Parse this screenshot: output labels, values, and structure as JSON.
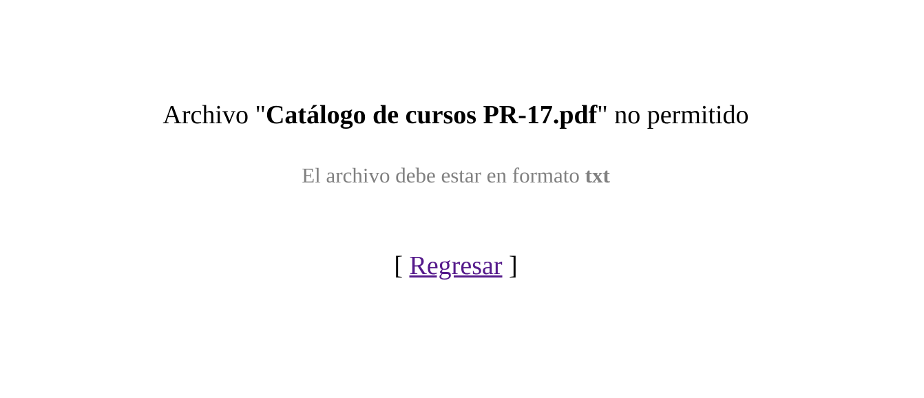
{
  "error": {
    "prefix": "Archivo \"",
    "filename": "Catálogo de cursos PR-17.pdf",
    "suffix": "\" no permitido"
  },
  "requirement": {
    "text": "El archivo debe estar en formato ",
    "format": "txt"
  },
  "back": {
    "open_bracket": "[ ",
    "link_label": "Regresar",
    "close_bracket": " ]"
  },
  "colors": {
    "text": "#000000",
    "muted": "#808080",
    "visited_link": "#551a8b"
  }
}
